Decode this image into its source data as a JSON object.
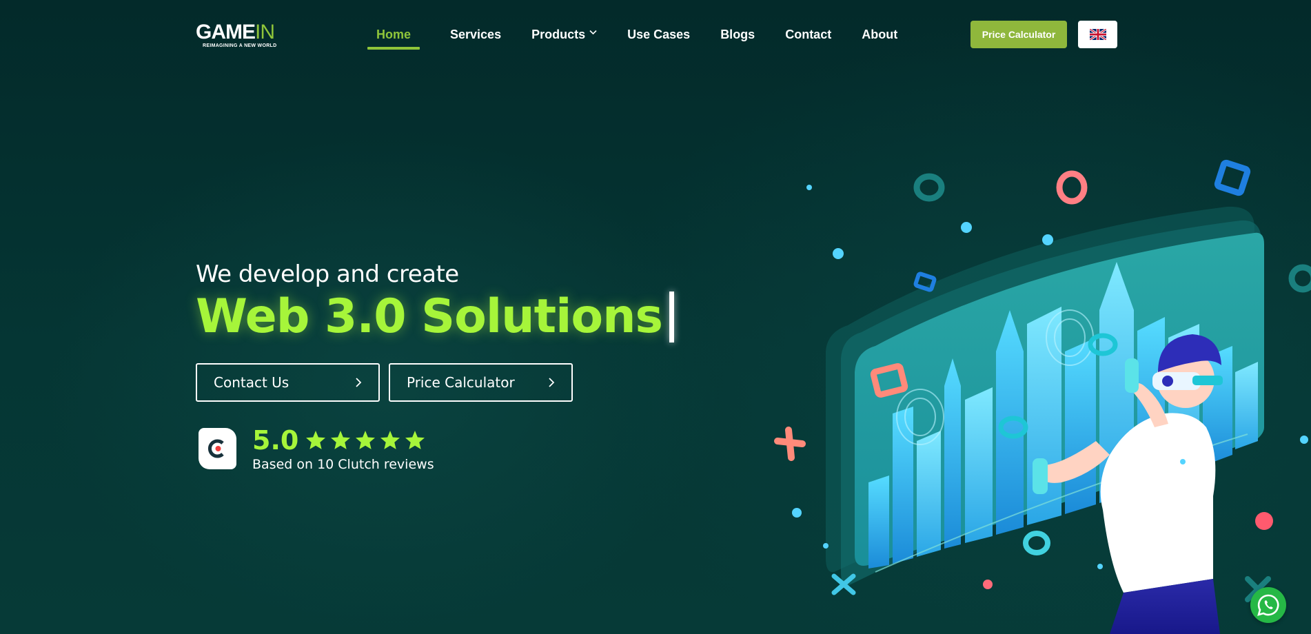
{
  "header": {
    "logo": {
      "main": "GAME",
      "accent": "IN",
      "tagline": "REIMAGINING A NEW WORLD"
    },
    "nav": [
      {
        "label": "Home",
        "active": true
      },
      {
        "label": "Services"
      },
      {
        "label": "Products",
        "has_dropdown": true
      },
      {
        "label": "Use Cases"
      },
      {
        "label": "Blogs"
      },
      {
        "label": "Contact"
      },
      {
        "label": "About"
      }
    ],
    "price_button": "Price Calculator",
    "language_icon": "uk-flag-icon"
  },
  "hero": {
    "subtitle": "We develop and create",
    "title": "Web 3.0 Solutions",
    "buttons": [
      {
        "label": "Contact Us",
        "icon": "chevron-right-icon"
      },
      {
        "label": "Price Calculator",
        "icon": "chevron-right-icon"
      }
    ]
  },
  "clutch": {
    "score": "5.0",
    "stars": 5,
    "text": "Based on 10 Clutch reviews"
  },
  "illustration": {
    "icon": "vr-city-illustration"
  },
  "floating": {
    "icon": "whatsapp-icon"
  },
  "colors": {
    "accent_green": "#8fc53a",
    "title_green": "#a6f53a",
    "background": "#032b2b",
    "button_green": "#8fb73c"
  }
}
